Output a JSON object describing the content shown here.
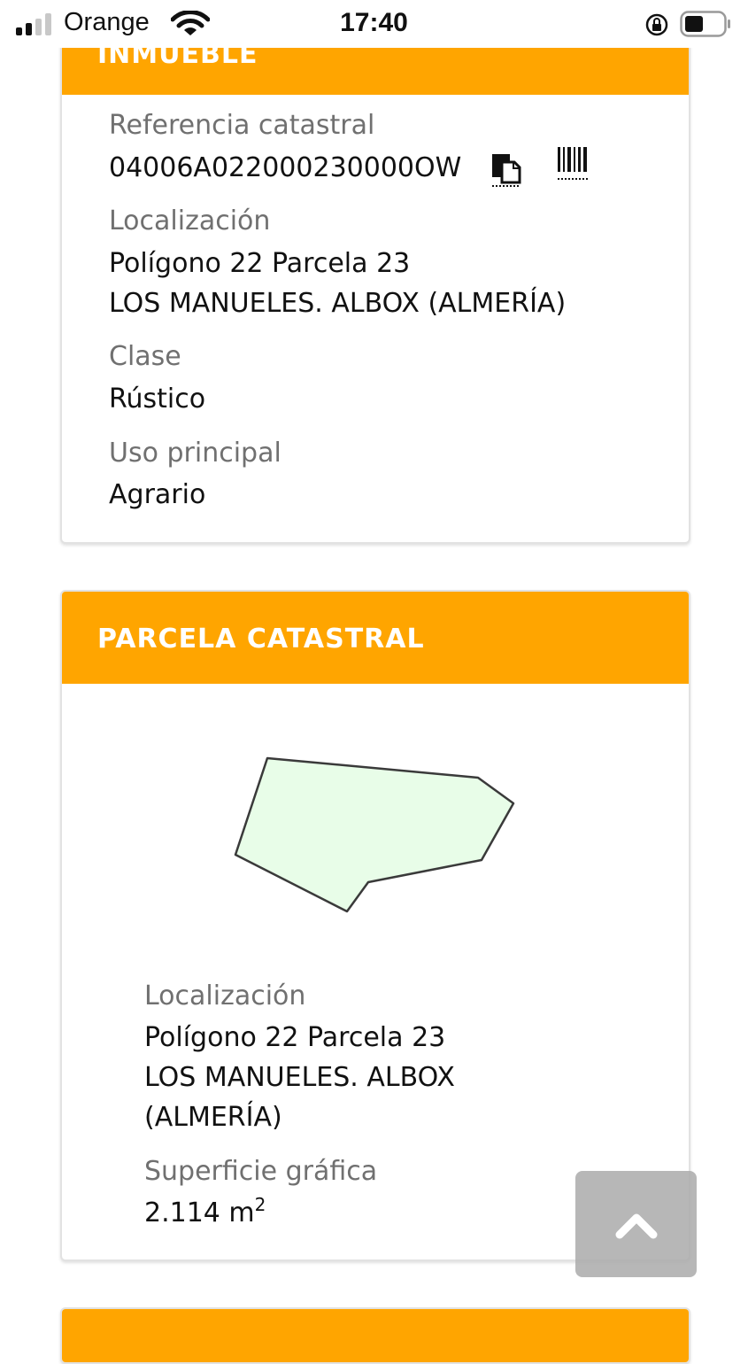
{
  "status_bar": {
    "carrier": "Orange",
    "time": "17:40"
  },
  "inmueble_card": {
    "title": "INMUEBLE",
    "fields": [
      {
        "label": "Referencia catastral",
        "value": "04006A022000230000OW"
      },
      {
        "label": "Localización",
        "value_line1": "Polígono 22 Parcela 23",
        "value_line2": "LOS MANUELES. ALBOX (ALMERÍA)"
      },
      {
        "label": "Clase",
        "value": "Rústico"
      },
      {
        "label": "Uso principal",
        "value": "Agrario"
      }
    ]
  },
  "parcela_card": {
    "title": "PARCELA CATASTRAL",
    "localizacion_label": "Localización",
    "localizacion_line1": "Polígono 22 Parcela 23",
    "localizacion_line2": "LOS MANUELES. ALBOX",
    "localizacion_line3": "(ALMERÍA)",
    "superficie_label": "Superficie gráfica",
    "superficie_value": "2.114 m",
    "superficie_unit_exp": "2"
  },
  "icons": {
    "copy": "copy-icon",
    "barcode": "barcode-icon",
    "scroll_top": "chevron-up-icon"
  },
  "colors": {
    "header": "#ffa500",
    "parcel_fill": "#e8fde8",
    "parcel_stroke": "#3a3a3a"
  }
}
